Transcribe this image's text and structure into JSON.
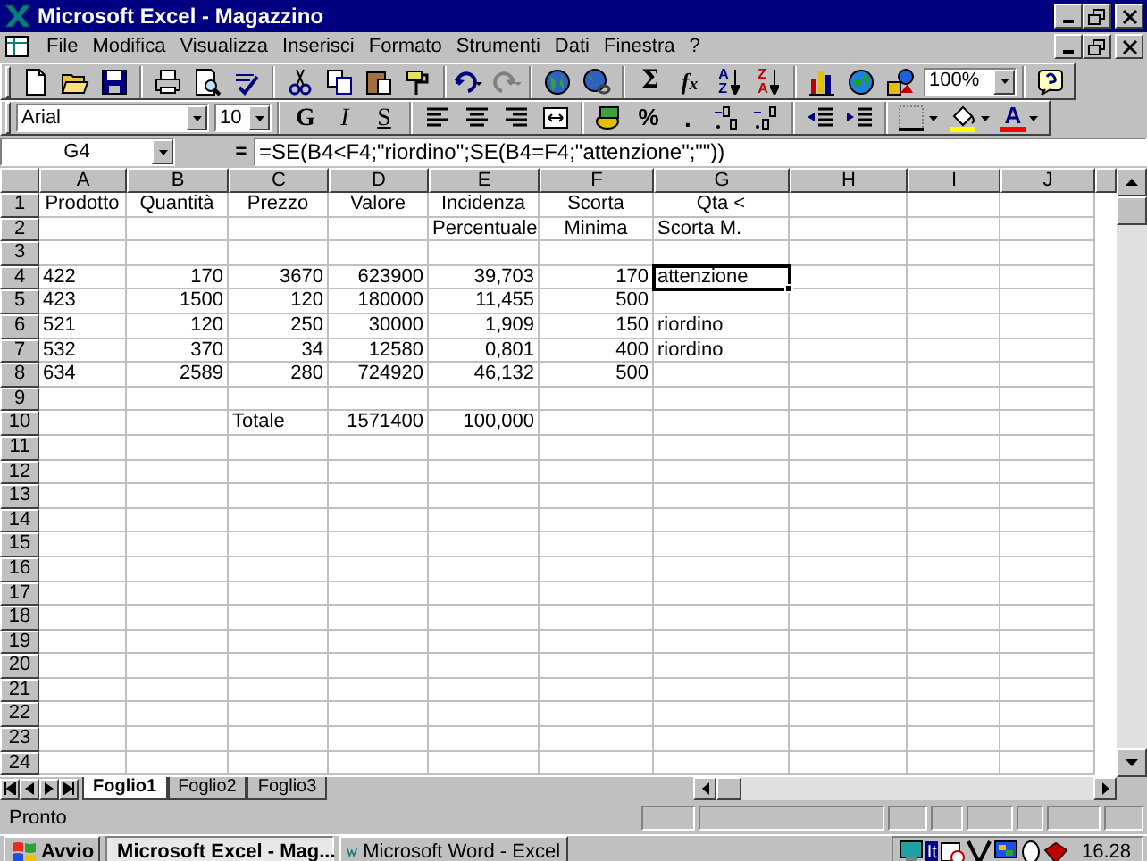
{
  "window": {
    "title": "Microsoft Excel - Magazzino"
  },
  "menu": [
    "File",
    "Modifica",
    "Visualizza",
    "Inserisci",
    "Formato",
    "Strumenti",
    "Dati",
    "Finestra",
    "?"
  ],
  "standard_toolbar": {
    "sum": "Σ",
    "function": "f$_{x}$",
    "sort_ascending": [
      "A",
      "Z"
    ],
    "sort_descending": [
      "Z",
      "A"
    ],
    "zoom": "100%"
  },
  "formatting_toolbar": {
    "font": "Arial",
    "size": "10",
    "bold": "G",
    "italic": "I",
    "underline": "S",
    "percent": "%",
    "thousands": ".",
    "font_color": "A"
  },
  "formula_bar": {
    "name_box": "G4",
    "equals": "=",
    "formula": "=SE(B4<F4;\"riordino\";SE(B4=F4;\"attenzione\";\"\"))"
  },
  "columns": [
    "A",
    "B",
    "C",
    "D",
    "E",
    "F",
    "G",
    "H",
    "I",
    "J"
  ],
  "rows": [
    {
      "header": "1",
      "cells": [
        {
          "text": "Prodotto",
          "kind": "heading",
          "selected": false
        },
        {
          "text": "Quantità",
          "kind": "heading",
          "selected": false
        },
        {
          "text": "Prezzo",
          "kind": "heading",
          "selected": false
        },
        {
          "text": "Valore",
          "kind": "heading",
          "selected": false
        },
        {
          "text": "Incidenza",
          "kind": "heading",
          "selected": false
        },
        {
          "text": "Scorta",
          "kind": "heading",
          "selected": false
        },
        {
          "text": "Qta <",
          "kind": "heading",
          "selected": false
        }
      ]
    },
    {
      "header": "2",
      "cells": [
        {},
        {},
        {},
        {},
        {
          "text": "Percentuale",
          "kind": "heading",
          "selected": false
        },
        {
          "text": "Minima",
          "kind": "heading",
          "selected": false
        },
        {
          "text": "Scorta M.",
          "kind": "text",
          "selected": false
        }
      ]
    },
    {
      "header": "3"
    },
    {
      "header": "4",
      "cells": [
        {
          "text": "422",
          "kind": "text",
          "selected": false
        },
        {
          "text": "170",
          "kind": "number",
          "selected": false
        },
        {
          "text": "3670",
          "kind": "number",
          "selected": false
        },
        {
          "text": "623900",
          "kind": "number",
          "selected": false
        },
        {
          "text": "39,703",
          "kind": "number",
          "selected": false
        },
        {
          "text": "170",
          "kind": "number",
          "selected": false
        },
        {
          "text": "attenzione",
          "kind": "text",
          "selected": true
        }
      ]
    },
    {
      "header": "5",
      "cells": [
        {
          "text": "423",
          "kind": "text",
          "selected": false
        },
        {
          "text": "1500",
          "kind": "number",
          "selected": false
        },
        {
          "text": "120",
          "kind": "number",
          "selected": false
        },
        {
          "text": "180000",
          "kind": "number",
          "selected": false
        },
        {
          "text": "11,455",
          "kind": "number",
          "selected": false
        },
        {
          "text": "500",
          "kind": "number",
          "selected": false
        }
      ]
    },
    {
      "header": "6",
      "cells": [
        {
          "text": "521",
          "kind": "text",
          "selected": false
        },
        {
          "text": "120",
          "kind": "number",
          "selected": false
        },
        {
          "text": "250",
          "kind": "number",
          "selected": false
        },
        {
          "text": "30000",
          "kind": "number",
          "selected": false
        },
        {
          "text": "1,909",
          "kind": "number",
          "selected": false
        },
        {
          "text": "150",
          "kind": "number",
          "selected": false
        },
        {
          "text": "riordino",
          "kind": "text",
          "selected": false
        }
      ]
    },
    {
      "header": "7",
      "cells": [
        {
          "text": "532",
          "kind": "text",
          "selected": false
        },
        {
          "text": "370",
          "kind": "number",
          "selected": false
        },
        {
          "text": "34",
          "kind": "number",
          "selected": false
        },
        {
          "text": "12580",
          "kind": "number",
          "selected": false
        },
        {
          "text": "0,801",
          "kind": "number",
          "selected": false
        },
        {
          "text": "400",
          "kind": "number",
          "selected": false
        },
        {
          "text": "riordino",
          "kind": "text",
          "selected": false
        }
      ]
    },
    {
      "header": "8",
      "cells": [
        {
          "text": "634",
          "kind": "text",
          "selected": false
        },
        {
          "text": "2589",
          "kind": "number",
          "selected": false
        },
        {
          "text": "280",
          "kind": "number",
          "selected": false
        },
        {
          "text": "724920",
          "kind": "number",
          "selected": false
        },
        {
          "text": "46,132",
          "kind": "number",
          "selected": false
        },
        {
          "text": "500",
          "kind": "number",
          "selected": false
        }
      ]
    },
    {
      "header": "9"
    },
    {
      "header": "10",
      "cells": [
        {},
        {},
        {
          "text": "Totale",
          "kind": "text",
          "selected": false
        },
        {
          "text": "1571400",
          "kind": "number",
          "selected": false
        },
        {
          "text": "100,000",
          "kind": "number",
          "selected": false
        }
      ]
    },
    {
      "header": "11"
    },
    {
      "header": "12"
    },
    {
      "header": "13"
    },
    {
      "header": "14"
    },
    {
      "header": "15"
    },
    {
      "header": "16"
    },
    {
      "header": "17"
    },
    {
      "header": "18"
    },
    {
      "header": "19"
    },
    {
      "header": "20"
    },
    {
      "header": "21"
    },
    {
      "header": "22"
    },
    {
      "header": "23"
    },
    {
      "header": "24"
    }
  ],
  "sheet_tabs": [
    {
      "label": "Foglio1",
      "selected": true
    },
    {
      "label": "Foglio2",
      "selected": false
    },
    {
      "label": "Foglio3",
      "selected": false
    }
  ],
  "status_bar": {
    "text": "Pronto"
  },
  "taskbar": {
    "start": "Avvio",
    "tasks": [
      {
        "label": "Microsoft Excel - Mag...",
        "selected": true
      },
      {
        "label": "Microsoft Word - Excel",
        "selected": false
      }
    ],
    "language": "It",
    "clock": "16.28"
  }
}
